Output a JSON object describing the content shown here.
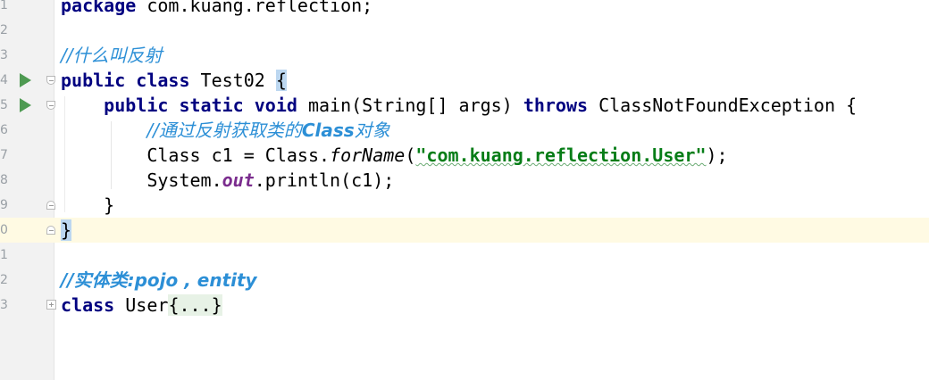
{
  "line_numbers": [
    "1",
    "2",
    "3",
    "4",
    "5",
    "6",
    "7",
    "8",
    "9",
    "0",
    "1",
    "2",
    "3"
  ],
  "code": {
    "l1": {
      "kw": "package",
      "rest": " com.kuang.reflection;"
    },
    "l3": {
      "comment": "//什么叫反射"
    },
    "l4": {
      "kw1": "public",
      "kw2": "class",
      "name": " Test02 ",
      "brace": "{"
    },
    "l5": {
      "indent": "    ",
      "kw1": "public",
      "kw2": "static",
      "kw3": "void",
      "sig": " main(String[] args) ",
      "kw4": "throws",
      "exc": " ClassNotFoundException {"
    },
    "l6": {
      "indent": "        ",
      "comment_prefix": "//通过反射获取类的",
      "comment_bold": "Class",
      "comment_suffix": "对象"
    },
    "l7": {
      "indent": "        ",
      "pre": "Class c1 = Class.",
      "method": "forName",
      "open": "(",
      "str": "\"com.kuang.reflection.User\"",
      "close": ");"
    },
    "l8": {
      "indent": "        ",
      "pre": "System.",
      "field": "out",
      "post": ".println(c1);"
    },
    "l9": {
      "indent": "    ",
      "brace": "}"
    },
    "l10": {
      "brace": "}"
    },
    "l12": {
      "comment": "//实体类:pojo , entity"
    },
    "l13": {
      "kw": "class",
      "name": " User",
      "folded": "{...}"
    }
  },
  "icons": {
    "run": "run-gutter-icon",
    "fold": "fold-marker-icon"
  },
  "colors": {
    "keyword": "#000080",
    "comment": "#2c8fd6",
    "string": "#067d17",
    "field": "#7b2d8e",
    "current_line": "#fffae3",
    "run": "#4e9a52"
  }
}
